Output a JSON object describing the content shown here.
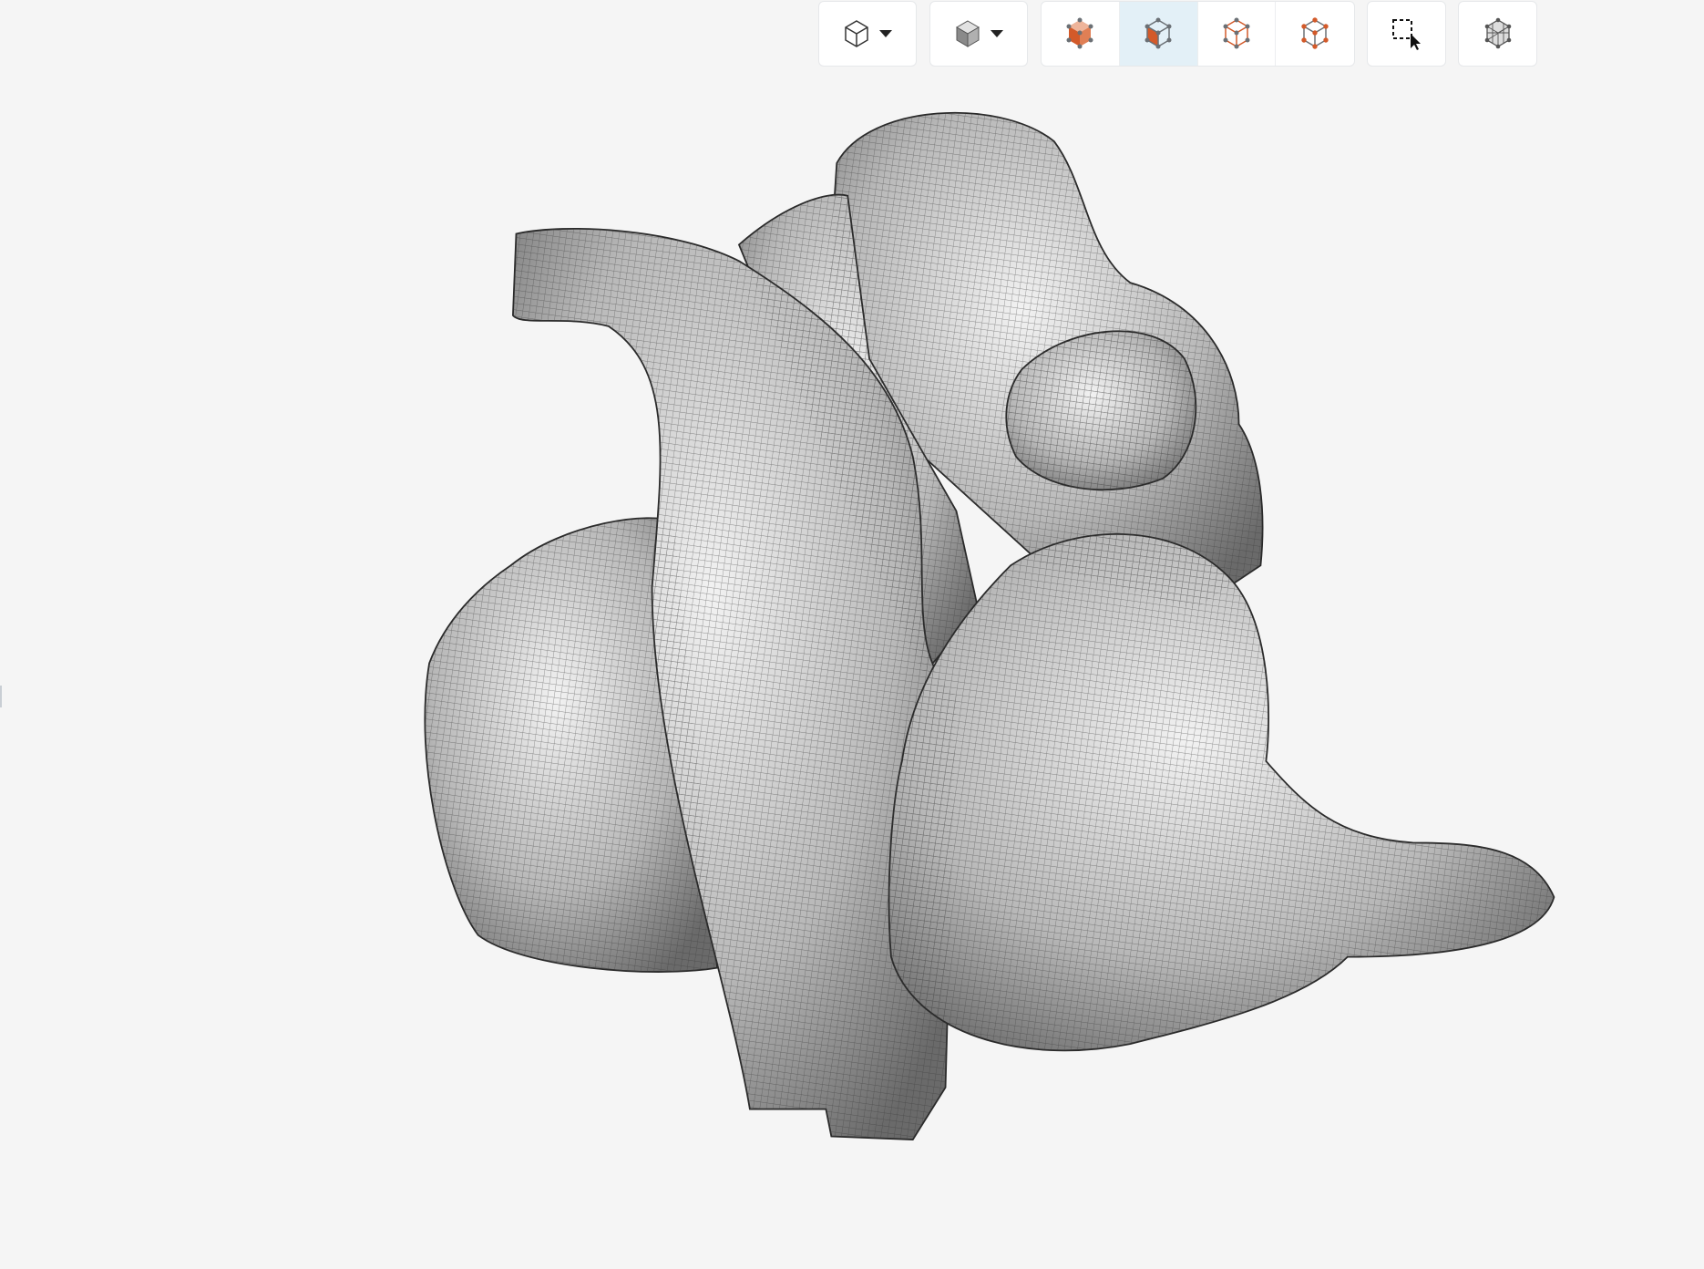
{
  "toolbar": {
    "view_dropdown": {
      "icon": "cube-outline-icon",
      "has_caret": true
    },
    "display_dropdown": {
      "icon": "cube-shaded-icon",
      "has_caret": true
    },
    "selection_mode": [
      {
        "icon": "select-cells-icon",
        "active": false
      },
      {
        "icon": "select-faces-icon",
        "active": true
      },
      {
        "icon": "select-edges-icon",
        "active": false
      },
      {
        "icon": "select-points-icon",
        "active": false
      }
    ],
    "box_select": {
      "icon": "box-select-cursor-icon"
    },
    "mesh_toggle": {
      "icon": "mesh-wireframe-icon"
    }
  },
  "colors": {
    "accent": "#d35a2a",
    "active_bg": "#e3f0f7",
    "background": "#f5f5f5",
    "mesh": "#9a9a9a"
  }
}
